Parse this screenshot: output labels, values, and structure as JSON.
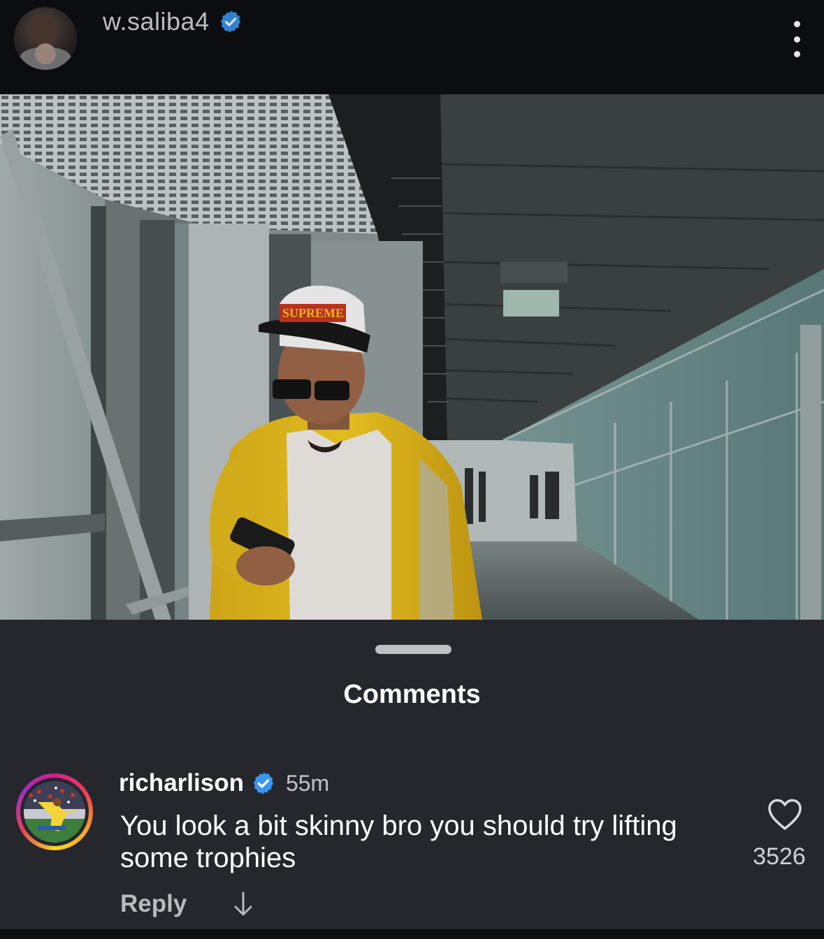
{
  "post": {
    "username": "w.saliba4",
    "verified": true
  },
  "photo": {
    "cap_text": "SUPREME"
  },
  "comments_sheet": {
    "title": "Comments",
    "comment": {
      "author": "richarlison",
      "verified": true,
      "time": "55m",
      "text": "You look a bit skinny bro you should try lifting some trophies",
      "reply_label": "Reply",
      "like_count": "3526"
    }
  },
  "icons": {
    "verified": "verified-badge-icon",
    "more": "more-options-icon",
    "like": "heart-icon",
    "translate": "arrow-down-icon"
  },
  "colors": {
    "verified_blue": "#3897f0",
    "sheet_background": "#25272d",
    "header_background": "#0c0d10"
  }
}
